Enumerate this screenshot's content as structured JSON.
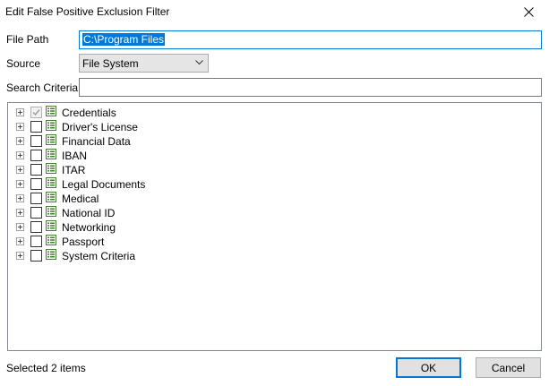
{
  "dialog": {
    "title": "Edit False Positive Exclusion Filter"
  },
  "form": {
    "file_path_label": "File Path",
    "file_path_value": "C:\\Program Files",
    "source_label": "Source",
    "source_value": "File System",
    "search_criteria_label": "Search Criteria",
    "search_criteria_value": ""
  },
  "tree": {
    "items": [
      {
        "label": "Credentials",
        "checked": true,
        "disabled": true
      },
      {
        "label": "Driver's License",
        "checked": false
      },
      {
        "label": "Financial Data",
        "checked": false
      },
      {
        "label": "IBAN",
        "checked": false
      },
      {
        "label": "ITAR",
        "checked": false
      },
      {
        "label": "Legal Documents",
        "checked": false
      },
      {
        "label": "Medical",
        "checked": false
      },
      {
        "label": "National ID",
        "checked": false
      },
      {
        "label": "Networking",
        "checked": false
      },
      {
        "label": "Passport",
        "checked": false
      },
      {
        "label": "System Criteria",
        "checked": false
      }
    ]
  },
  "status": {
    "text": "Selected 2 items"
  },
  "buttons": {
    "ok": "OK",
    "cancel": "Cancel"
  },
  "colors": {
    "accent": "#0078d7",
    "icon_green": "#4b7a3a"
  },
  "icons": {
    "close": "close-icon",
    "dropdown": "chevron-down-icon",
    "expander": "plus-expander-icon",
    "category": "list-icon"
  }
}
